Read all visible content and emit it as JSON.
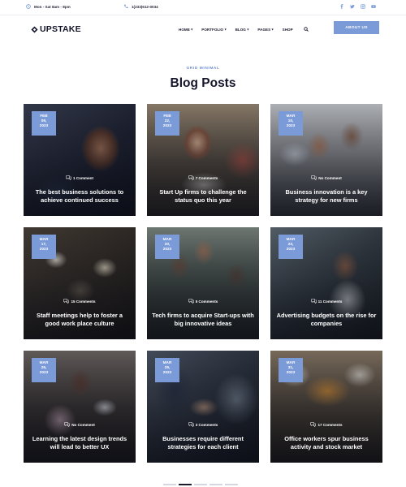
{
  "topbar": {
    "hours": "Mon - Sat 8am - 8pm",
    "phone": "1(233)612-0034",
    "social_icons": [
      "facebook-icon",
      "twitter-icon",
      "instagram-icon",
      "youtube-icon"
    ]
  },
  "header": {
    "logo": "UPSTAKE",
    "nav": [
      {
        "label": "HOME",
        "has_dropdown": true
      },
      {
        "label": "PORTFOLIO",
        "has_dropdown": true
      },
      {
        "label": "BLOG",
        "has_dropdown": true
      },
      {
        "label": "PAGES",
        "has_dropdown": true
      },
      {
        "label": "SHOP",
        "has_dropdown": false
      }
    ],
    "cta": "ABOUT US"
  },
  "section": {
    "eyebrow": "GRID MINIMAL",
    "title": "Blog Posts"
  },
  "colors": {
    "accent": "#7b9ad8",
    "dark": "#14142b"
  },
  "posts": [
    {
      "month": "FEB",
      "day": "09,",
      "year": "2023",
      "comments": "1 Comment",
      "title": "The best business solutions to achieve continued success"
    },
    {
      "month": "FEB",
      "day": "22,",
      "year": "2023",
      "comments": "7 Comments",
      "title": "Start Up firms to challenge the status quo this year"
    },
    {
      "month": "MAR",
      "day": "10,",
      "year": "2023",
      "comments": "No Comment",
      "title": "Business innovation is a key strategy for new firms"
    },
    {
      "month": "MAR",
      "day": "17,",
      "year": "2023",
      "comments": "15 Comments",
      "title": "Staff meetings help to foster a good work place culture"
    },
    {
      "month": "MAR",
      "day": "20,",
      "year": "2023",
      "comments": "5 Comments",
      "title": "Tech firms to acquire Start-ups with big innovative ideas"
    },
    {
      "month": "MAR",
      "day": "23,",
      "year": "2023",
      "comments": "11 Comments",
      "title": "Advertising budgets on the rise for companies"
    },
    {
      "month": "MAR",
      "day": "26,",
      "year": "2023",
      "comments": "No Comment",
      "title": "Learning the latest design trends will lead to better UX"
    },
    {
      "month": "MAR",
      "day": "29,",
      "year": "2023",
      "comments": "3 Comments",
      "title": "Businesses require different strategies for each client"
    },
    {
      "month": "MAR",
      "day": "31,",
      "year": "2023",
      "comments": "17 Comments",
      "title": "Office workers spur business activity and stock market"
    }
  ],
  "pagination": {
    "pages": 5,
    "active": 2
  }
}
